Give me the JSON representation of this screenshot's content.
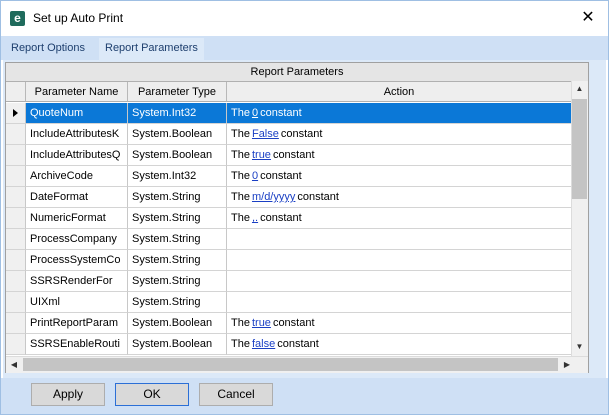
{
  "window": {
    "title": "Set up Auto Print",
    "app_icon_letter": "e"
  },
  "tabs": [
    {
      "label": "Report Options",
      "active": false
    },
    {
      "label": "Report Parameters",
      "active": true
    }
  ],
  "grid": {
    "caption": "Report Parameters",
    "columns": [
      "Parameter Name",
      "Parameter Type",
      "Action"
    ],
    "rows": [
      {
        "name": "QuoteNum",
        "type": "System.Int32",
        "action": {
          "pre": "The",
          "link": "0",
          "post": "constant"
        },
        "selected": true
      },
      {
        "name": "IncludeAttributesK",
        "type": "System.Boolean",
        "action": {
          "pre": "The",
          "link": "False",
          "post": "constant"
        }
      },
      {
        "name": "IncludeAttributesQ",
        "type": "System.Boolean",
        "action": {
          "pre": "The",
          "link": "true",
          "post": "constant"
        }
      },
      {
        "name": "ArchiveCode",
        "type": "System.Int32",
        "action": {
          "pre": "The",
          "link": "0",
          "post": "constant"
        }
      },
      {
        "name": "DateFormat",
        "type": "System.String",
        "action": {
          "pre": "The",
          "link": "m/d/yyyy",
          "post": "constant"
        }
      },
      {
        "name": "NumericFormat",
        "type": "System.String",
        "action": {
          "pre": "The",
          "link": ",.",
          "post": "constant"
        }
      },
      {
        "name": "ProcessCompany",
        "type": "System.String",
        "action": null
      },
      {
        "name": "ProcessSystemCo",
        "type": "System.String",
        "action": null
      },
      {
        "name": "SSRSRenderFor",
        "type": "System.String",
        "action": null
      },
      {
        "name": "UIXml",
        "type": "System.String",
        "action": null
      },
      {
        "name": "PrintReportParam",
        "type": "System.Boolean",
        "action": {
          "pre": "The",
          "link": "true",
          "post": "constant"
        }
      },
      {
        "name": "SSRSEnableRouti",
        "type": "System.Boolean",
        "action": {
          "pre": "The",
          "link": "false",
          "post": "constant"
        }
      }
    ]
  },
  "buttons": {
    "apply": "Apply",
    "ok": "OK",
    "cancel": "Cancel"
  },
  "icons": {
    "close": "close-icon",
    "row_selector": "row-pointer-icon"
  }
}
